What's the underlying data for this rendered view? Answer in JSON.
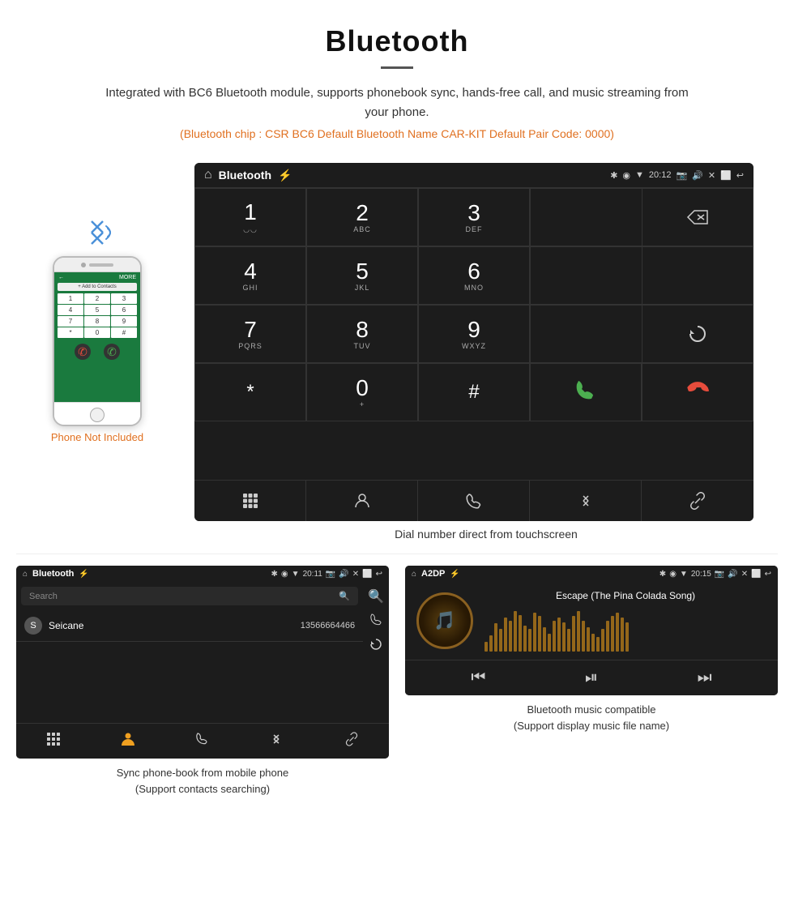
{
  "page": {
    "title": "Bluetooth",
    "description": "Integrated with BC6 Bluetooth module, supports phonebook sync, hands-free call, and music streaming from your phone.",
    "specs": "(Bluetooth chip : CSR BC6    Default Bluetooth Name CAR-KIT    Default Pair Code: 0000)"
  },
  "dial_screen": {
    "status_bar": {
      "home_symbol": "⌂",
      "title": "Bluetooth",
      "usb_symbol": "⚡",
      "time": "20:12",
      "icons_right": "🔷 ◉ ▼ 📷 🔊 ✕ ⬜ ↩"
    },
    "keys": [
      {
        "num": "1",
        "sub": "◡◡"
      },
      {
        "num": "2",
        "sub": "ABC"
      },
      {
        "num": "3",
        "sub": "DEF"
      },
      {
        "num": "",
        "sub": ""
      },
      {
        "num": "⌫",
        "sub": ""
      },
      {
        "num": "4",
        "sub": "GHI"
      },
      {
        "num": "5",
        "sub": "JKL"
      },
      {
        "num": "6",
        "sub": "MNO"
      },
      {
        "num": "",
        "sub": ""
      },
      {
        "num": "",
        "sub": ""
      },
      {
        "num": "7",
        "sub": "PQRS"
      },
      {
        "num": "8",
        "sub": "TUV"
      },
      {
        "num": "9",
        "sub": "WXYZ"
      },
      {
        "num": "",
        "sub": ""
      },
      {
        "num": "↺",
        "sub": ""
      },
      {
        "num": "*",
        "sub": ""
      },
      {
        "num": "0",
        "sub": "+"
      },
      {
        "num": "#",
        "sub": ""
      },
      {
        "num": "📞",
        "sub": "green"
      },
      {
        "num": "📞",
        "sub": "red"
      }
    ],
    "bottom_icons": [
      "⊞",
      "👤",
      "📞",
      "✱",
      "🔗"
    ],
    "caption": "Dial number direct from touchscreen"
  },
  "phonebook_screen": {
    "status_bar_title": "Bluetooth",
    "status_time": "20:11",
    "search_placeholder": "Search",
    "contacts": [
      {
        "initial": "S",
        "name": "Seicane",
        "number": "13566664466"
      }
    ],
    "caption_line1": "Sync phone-book from mobile phone",
    "caption_line2": "(Support contacts searching)"
  },
  "music_screen": {
    "status_bar_title": "A2DP",
    "status_time": "20:15",
    "song_title": "Escape (The Pina Colada Song)",
    "caption_line1": "Bluetooth music compatible",
    "caption_line2": "(Support display music file name)"
  },
  "phone_section": {
    "not_included_text": "Phone Not Included"
  },
  "music_bar_heights": [
    12,
    20,
    35,
    28,
    42,
    38,
    50,
    45,
    32,
    28,
    48,
    44,
    30,
    22,
    38,
    42,
    36,
    28,
    44,
    50,
    38,
    30,
    22,
    18,
    28,
    38,
    44,
    48,
    42,
    36
  ]
}
